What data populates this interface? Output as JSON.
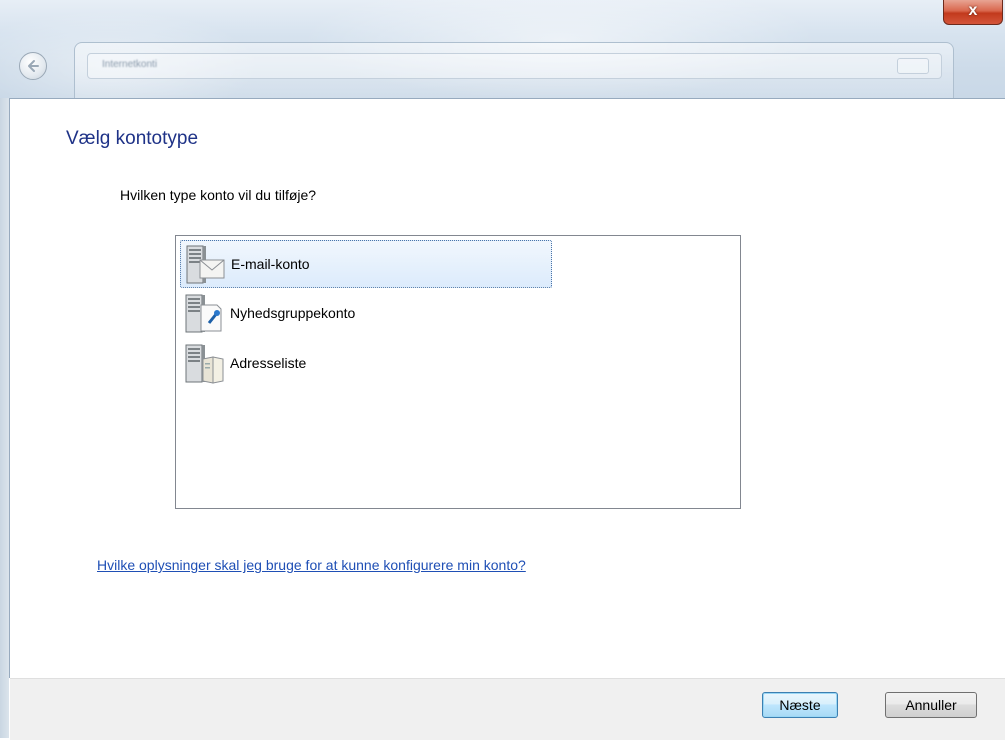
{
  "window": {
    "close_glyph": "x",
    "address_text": "Internetkonti"
  },
  "page": {
    "heading": "Vælg kontotype",
    "question": "Hvilken type konto vil du tilføje?",
    "account_types": [
      {
        "label": "E-mail-konto",
        "icon": "email-server-icon",
        "selected": true
      },
      {
        "label": "Nyhedsgruppekonto",
        "icon": "newsgroup-server-icon",
        "selected": false
      },
      {
        "label": "Adresseliste",
        "icon": "directory-server-icon",
        "selected": false
      }
    ],
    "help_link": "Hvilke oplysninger skal jeg bruge for at kunne konfigurere min konto?"
  },
  "footer": {
    "next_label": "Næste",
    "cancel_label": "Annuller"
  },
  "colors": {
    "heading": "#1e3287",
    "link": "#1f4fb5",
    "selection": "#dcebfc"
  }
}
